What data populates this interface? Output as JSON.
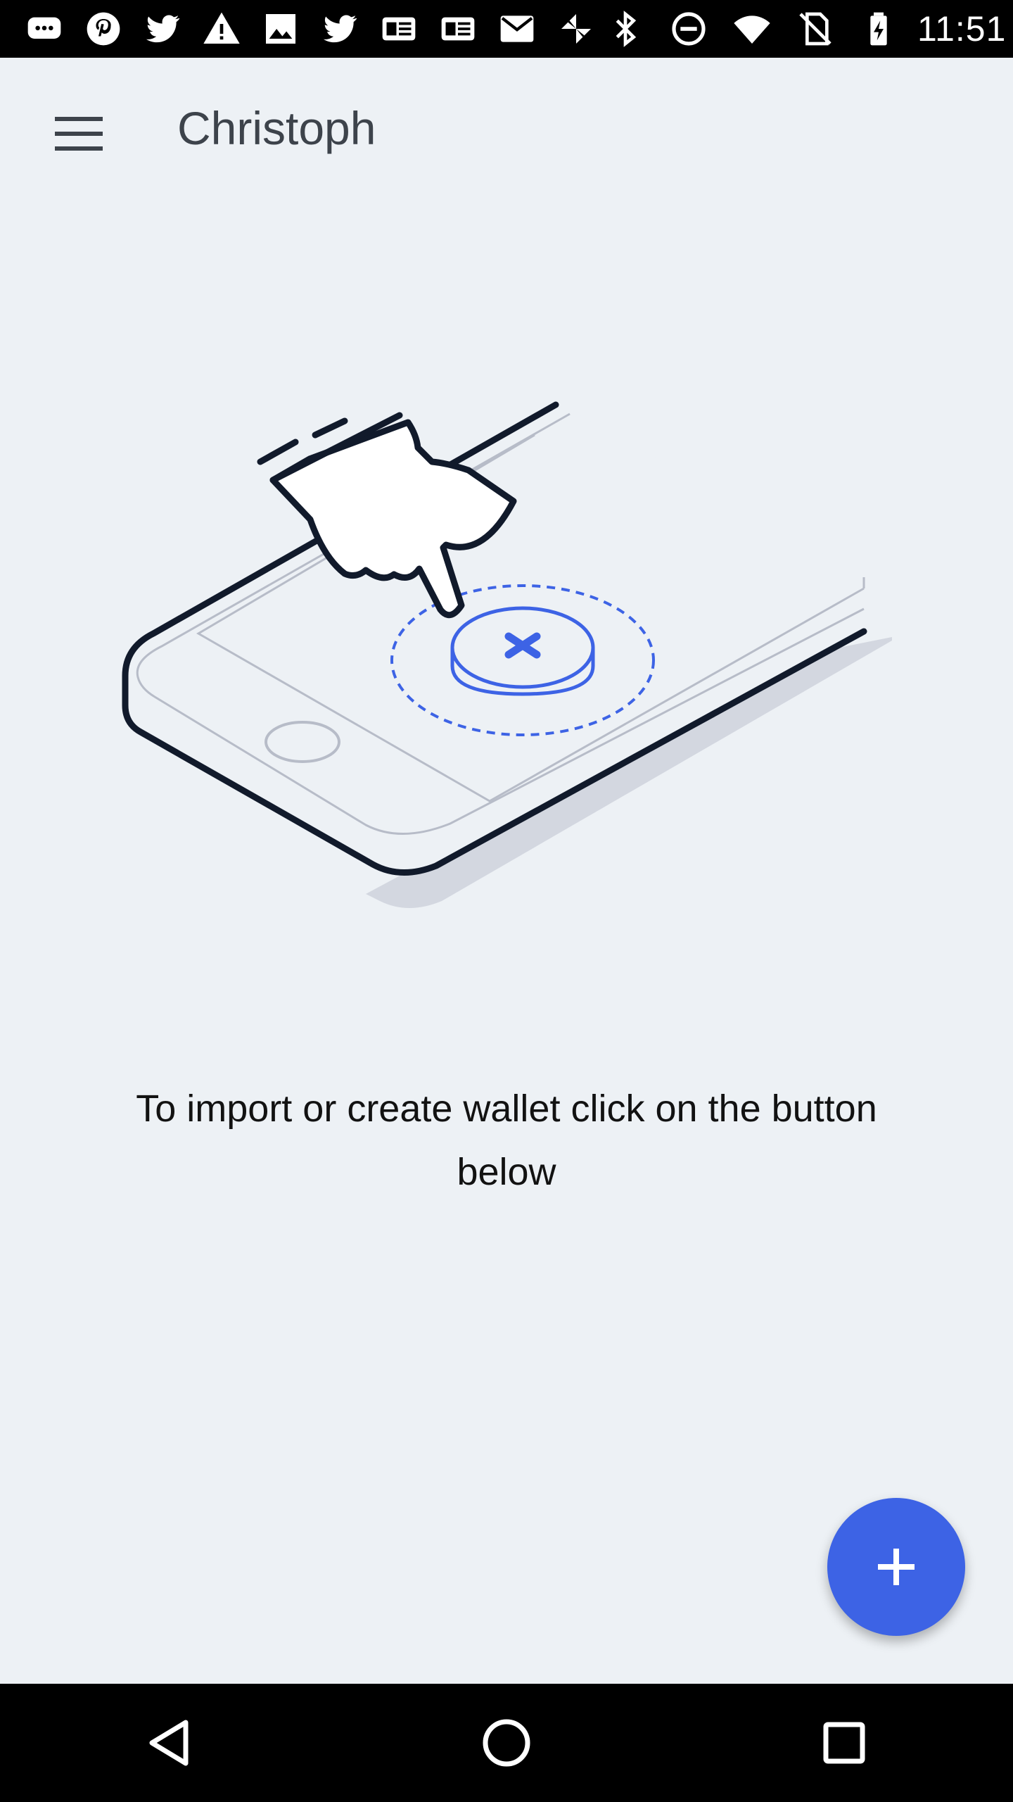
{
  "status_bar": {
    "time": "11:51",
    "left_icons": [
      "chat-icon",
      "pinterest-icon",
      "twitter-icon",
      "warning-icon",
      "image-icon",
      "twitter-icon",
      "news-icon",
      "news-icon",
      "mail-icon",
      "pinwheel-icon"
    ],
    "right_icons": [
      "bluetooth-icon",
      "do-not-disturb-icon",
      "wifi-icon",
      "no-sim-icon",
      "battery-charging-icon"
    ]
  },
  "app_bar": {
    "title": "Christoph",
    "menu_icon": "menu-icon"
  },
  "main": {
    "message": "To import or create wallet click on the button below"
  },
  "fab": {
    "icon": "plus-icon"
  },
  "colors": {
    "background": "#edf1f5",
    "accent": "#3d63e5",
    "title": "#3d434b",
    "text": "#121212"
  },
  "nav_bar": {
    "icons": [
      "back-icon",
      "home-icon",
      "recents-icon"
    ]
  }
}
